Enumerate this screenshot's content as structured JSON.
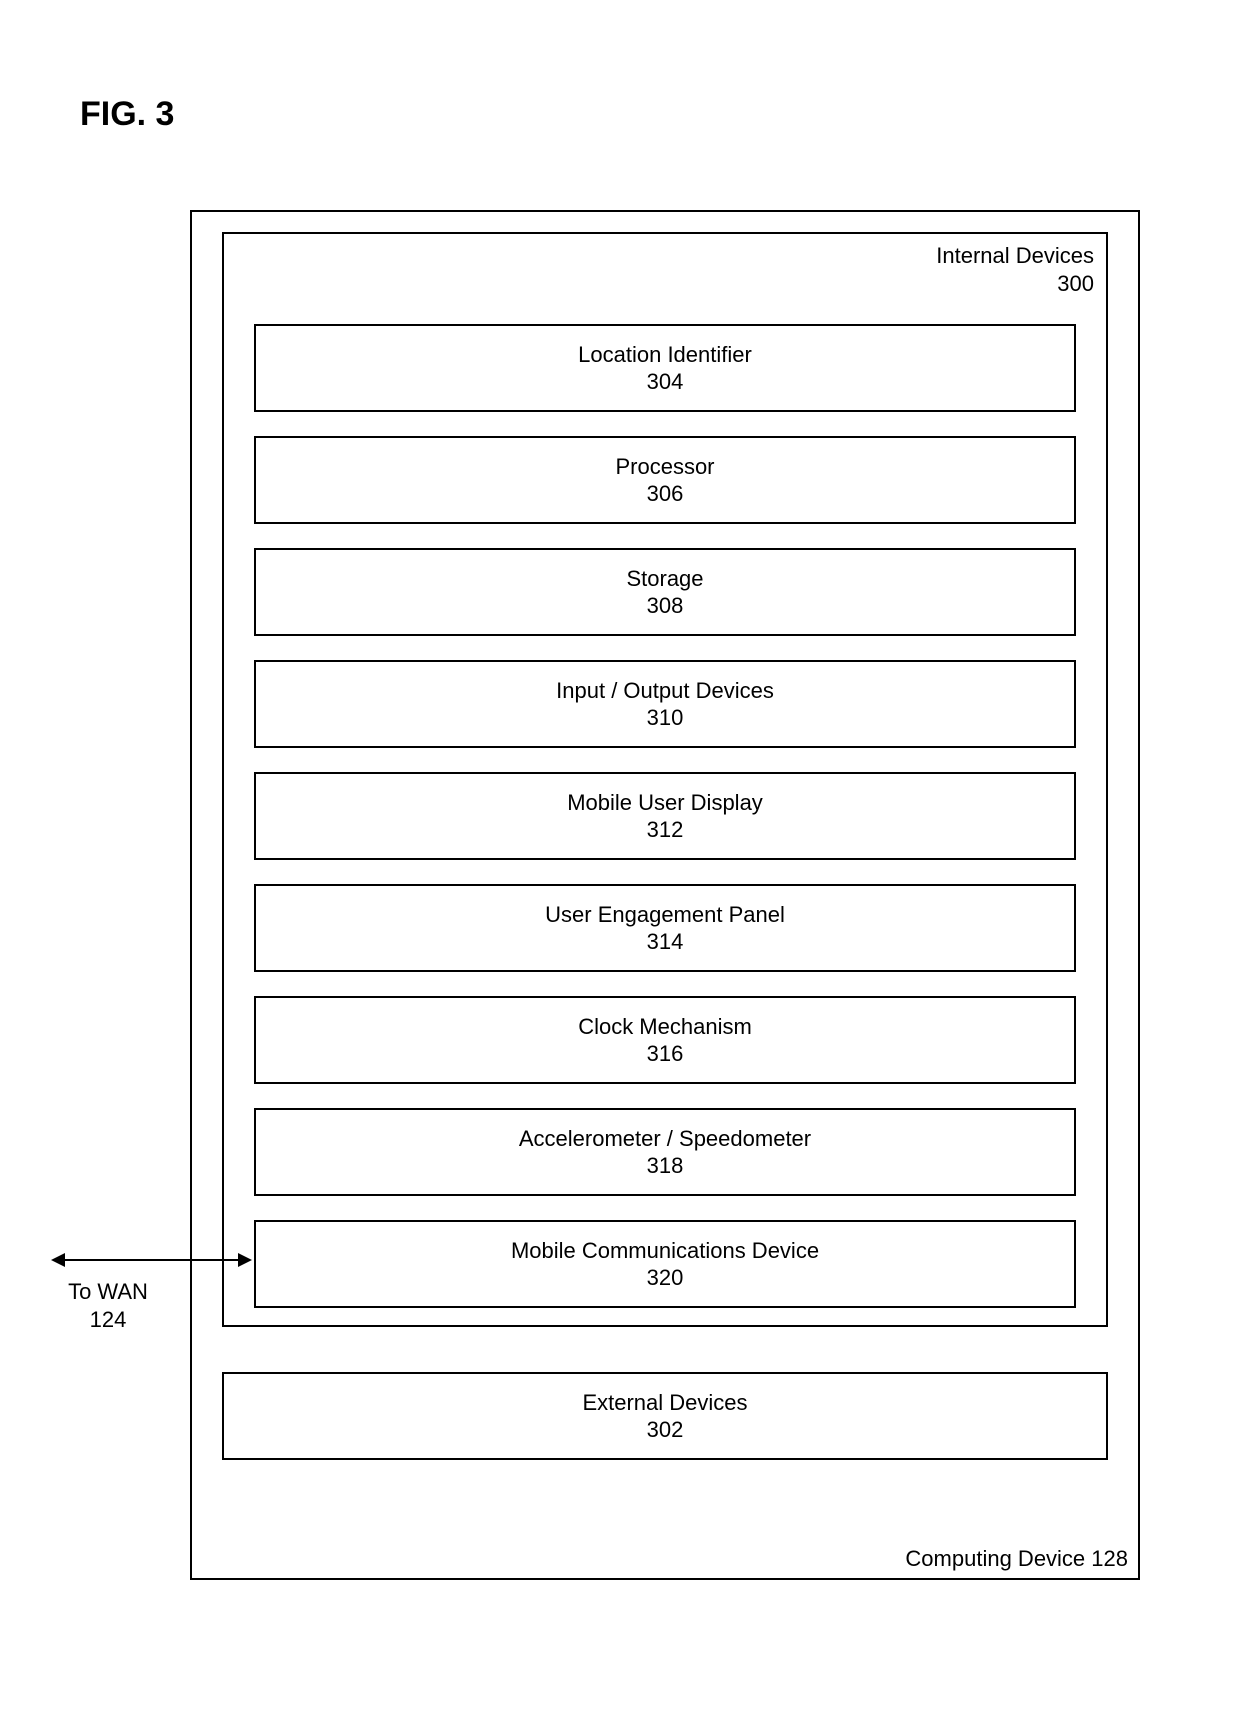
{
  "figure_label": "FIG. 3",
  "outer": {
    "label": "Computing Device 128"
  },
  "internal": {
    "title": "Internal Devices",
    "ref": "300",
    "components": [
      {
        "name": "Location Identifier",
        "ref": "304"
      },
      {
        "name": "Processor",
        "ref": "306"
      },
      {
        "name": "Storage",
        "ref": "308"
      },
      {
        "name": "Input / Output Devices",
        "ref": "310"
      },
      {
        "name": "Mobile User Display",
        "ref": "312"
      },
      {
        "name": "User Engagement Panel",
        "ref": "314"
      },
      {
        "name": "Clock Mechanism",
        "ref": "316"
      },
      {
        "name": "Accelerometer / Speedometer",
        "ref": "318"
      },
      {
        "name": "Mobile Communications Device",
        "ref": "320"
      }
    ]
  },
  "external": {
    "name": "External Devices",
    "ref": "302"
  },
  "connection": {
    "label": "To WAN",
    "ref": "124"
  }
}
